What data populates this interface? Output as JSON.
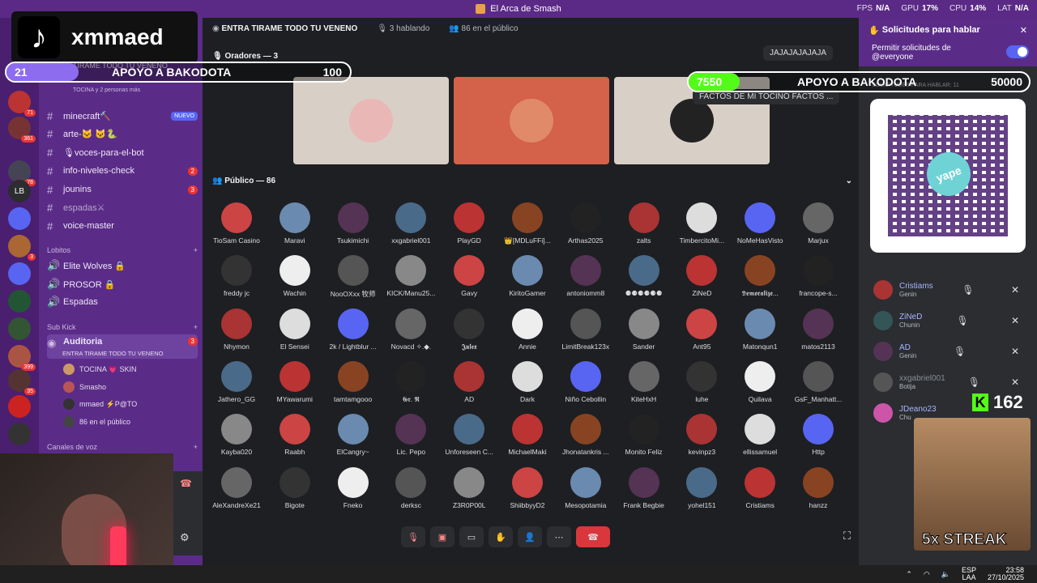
{
  "window": {
    "title": "El Arca de Smash"
  },
  "perf": [
    {
      "k": "FPS",
      "v": "N/A"
    },
    {
      "k": "GPU",
      "v": "17%"
    },
    {
      "k": "CPU",
      "v": "14%"
    },
    {
      "k": "LAT",
      "v": "N/A"
    }
  ],
  "overlay": {
    "tiktok_user": "xmmaed",
    "goal_left": {
      "count": "21",
      "label": "APOYO A BAKODOTA",
      "target": "100",
      "progress": 0.21
    },
    "goal_right": {
      "count": "7550",
      "label": "APOYO A BAKODOTA",
      "target": "50000",
      "progress": 0.151
    },
    "kick_count": "162",
    "streak": "5x STREAK"
  },
  "sidebar": {
    "partial_top": "A TIRAME TODO TU VENENO",
    "partial_sub": "TOCINA y 2 personas más",
    "channels": [
      {
        "name": "minecraft🔨",
        "tag": "NUEVO"
      },
      {
        "name": "arte-🐱 🐱🐍",
        "pill": ""
      },
      {
        "name": "🎙voces-para-el-bot",
        "pill": ""
      },
      {
        "name": "info-niveles-check",
        "pill": "2"
      },
      {
        "name": "jounins",
        "pill": "3"
      },
      {
        "name": "espadas⚔",
        "pill": ""
      },
      {
        "name": "voice-master",
        "pill": ""
      }
    ],
    "cat_lobitos": "Lobitos",
    "lobitos": [
      "Elite Wolves 🔒",
      "PROSOR 🔒",
      "Espadas"
    ],
    "cat_subkick": "Sub Kick",
    "auditoria": "Auditoria",
    "auditoria_badge": "3",
    "auditoria_sub": "ENTRA TIRAME TODO TU VENENO",
    "voice_users": [
      "TOCINA 💗 SKIN",
      "Smasho",
      "mmaed ⚡P@TO",
      "86 en el público"
    ],
    "cat_voz": "Canales de voz"
  },
  "stage": {
    "title": "ENTRA TIRAME TODO TU VENENO",
    "speaking": "3 hablando",
    "audience_count": "86 en el público",
    "speakers_label": "Oradores — 3",
    "public_label": "Público — 86",
    "float_msg1": "JAJAJAJAJAJA",
    "float_msg2": "FACTOS DE MI TOCINO FACTOS ..."
  },
  "members": [
    "TioSam Casino",
    "Maravi",
    "Tsukimichi",
    "xxgabriel001",
    "PlayGD",
    "👑[MDLuFFi]...",
    "Arthas2025",
    "zalts",
    "TimbercitoMi...",
    "NoMeHasVisto",
    "Marjux",
    "freddy jc",
    "Wachin",
    "NooOXxx 牧师",
    "KICK/Manu25...",
    "Gavy",
    "KiritoGamer",
    "antoniomm8",
    "⚈⚈⚈⚈⚈⚈",
    "ZiNeD",
    "𝕯𝖊𝖒𝖔𝖗𝖆𝖑𝖎𝖟𝖊...",
    "francope-s...",
    "Nhymon",
    "El Sensei",
    "2k / Lightblur ...",
    "Novacd ✧.◆.",
    "𝕵𝖚𝖑𝖊𝖝",
    "Annie",
    "LimitBreak123x",
    "Sander",
    "Ant95",
    "Matonqun1",
    "matos2113",
    "Jathero_GG",
    "MYawarumi",
    "tamtamgooo",
    "𝕲𝖗. 𝕽",
    "AD",
    "Dark",
    "Niño Cebollin",
    "KiteHxH",
    "luhe",
    "Quilava",
    "GsF_Manhatt...",
    "Kayba020",
    "Raabh",
    "ElCangry~",
    "Lic. Pepo",
    "Unforeseen C...",
    "MichaelMaki",
    "Jhonatankris ...",
    "Monito Feliz",
    "kevinpz3",
    "ellissamuel",
    "Http",
    "AleXandreXe21",
    "Bigote",
    "Fneko",
    "derksc",
    "Z3R0P00L",
    "ShiibbyyD2",
    "Mesopotamia",
    "Frank Begbie",
    "yohel151",
    "Cristiams",
    "hanzz"
  ],
  "requests": {
    "title": "Solicitudes para hablar",
    "permit_line1": "Permitir solicitudes de",
    "permit_line2": "@everyone",
    "count_label": "SOLICITUDES PARA HABLAR: 11",
    "qr_brand": "yape",
    "users": [
      {
        "name": "Cristiams",
        "role": "Genin"
      },
      {
        "name": "ZiNeD",
        "role": "Chunin"
      },
      {
        "name": "AD",
        "role": "Genin"
      },
      {
        "name": "xxgabriel001",
        "role": "Botija"
      },
      {
        "name": "JDeano23",
        "role": "Chu"
      }
    ]
  },
  "taskbar": {
    "lang1": "ESP",
    "lang2": "LAA",
    "time": "23:58",
    "date": "27/10/2025"
  },
  "colors": {
    "purple_dark": "#4a1f70",
    "purple": "#5a2c88",
    "accent": "#5865f2",
    "kick": "#53fc18"
  }
}
